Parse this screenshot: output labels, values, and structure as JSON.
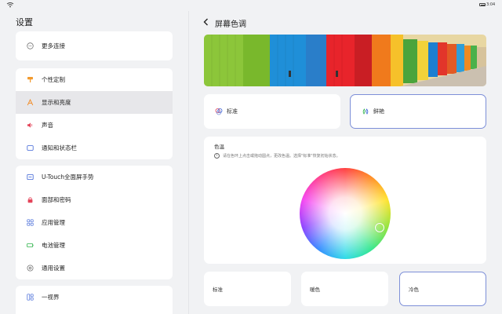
{
  "status_bar": {
    "time": "3:04",
    "wifi_icon": "wifi-icon",
    "battery_icon": "battery-icon"
  },
  "settings": {
    "title": "设置",
    "groups": [
      {
        "items": [
          {
            "label": "更多连接",
            "icon": "more-connections-icon"
          }
        ]
      },
      {
        "items": [
          {
            "label": "个性定制",
            "icon": "personalization-icon"
          },
          {
            "label": "显示和亮度",
            "icon": "display-brightness-icon",
            "active": true
          },
          {
            "label": "声音",
            "icon": "sound-icon"
          },
          {
            "label": "通知和状态栏",
            "icon": "notification-icon"
          }
        ]
      },
      {
        "items": [
          {
            "label": "U-Touch全面屏手势",
            "icon": "gesture-icon"
          },
          {
            "label": "面部和密码",
            "icon": "lock-icon"
          },
          {
            "label": "应用管理",
            "icon": "apps-icon"
          },
          {
            "label": "电池管理",
            "icon": "battery-manage-icon"
          },
          {
            "label": "通用设置",
            "icon": "general-settings-icon"
          }
        ]
      },
      {
        "items": [
          {
            "label": "一视界",
            "icon": "multi-view-icon"
          }
        ]
      }
    ]
  },
  "detail": {
    "title": "屏幕色调",
    "back_icon": "back-arrow-icon",
    "modes": [
      {
        "label": "标准",
        "icon": "standard-mode-icon",
        "selected": false
      },
      {
        "label": "鲜艳",
        "icon": "vivid-mode-icon",
        "selected": true
      }
    ],
    "temperature": {
      "label": "色温",
      "hint": "请在色环上点击或拖动圆点，更改色温。选择\"标准\"恢复初始状态。"
    },
    "presets": [
      {
        "label": "标准",
        "selected": false
      },
      {
        "label": "暖色",
        "selected": false
      },
      {
        "label": "冷色",
        "selected": true
      }
    ]
  },
  "colors": {
    "accent_border": "#7d8fd8",
    "active_row": "#e7e7ea",
    "background": "#f1f2f4"
  }
}
